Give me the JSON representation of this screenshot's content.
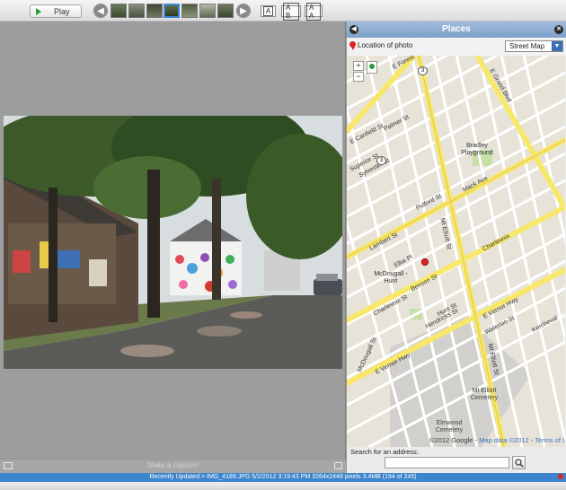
{
  "toolbar": {
    "play_label": "Play",
    "compare_buttons": [
      "A",
      "A B",
      "A A"
    ]
  },
  "viewer": {
    "caption_placeholder": "Make a caption!"
  },
  "places": {
    "title": "Places",
    "location_label": "Location of photo",
    "map_type": "Street Map",
    "zoom_in": "+",
    "zoom_out": "−",
    "copyright": "©2012 Google",
    "map_data": "Map data ©2012",
    "terms": "Terms of Use",
    "search_label": "Search for an address:",
    "search_value": ""
  },
  "map_labels": {
    "bradley": "Bradley Playground",
    "mcdougall": "McDougall - Hunt",
    "mt_elliott": "Mt Elliott Cemetery",
    "elmwood": "Elmwood Cemetery",
    "mack": "Mack Ave",
    "charlevoix": "Charlevoix",
    "charlevoix2": "Charlevoix St",
    "vernor": "E Vernor Hwy",
    "vernor2": "E Vernor Hwy",
    "grand": "E Grand Blvd",
    "elliott": "Mt Elliott St",
    "elliott2": "Mt Elliott St",
    "ferry": "E Forest",
    "canfield": "E Canfield St",
    "kercheval": "Kercheval",
    "benson": "Benson St",
    "heidelberg": "Elba Pl",
    "hunt": "Hunt St",
    "mcdougall_st": "McDougall St",
    "sylvester": "Sylvester St",
    "superior": "Superior St",
    "palmer": "Palmer St",
    "pulford": "Pulford St",
    "lambert": "Lambert St",
    "hendricks": "Hendricks St",
    "waterloo": "Waterloo St",
    "route3": "3"
  },
  "status": {
    "text": "Recently Updated > IMG_4189.JPG    5/2/2012 3:19:43 PM    3264x2448 pixels    3.4MB    (194 of 245)"
  },
  "colors": {
    "status_bar": "#3c84cc",
    "places_header": "#8fb0d6",
    "major_road": "#f7e76b",
    "map_bg": "#e8e3d9"
  }
}
